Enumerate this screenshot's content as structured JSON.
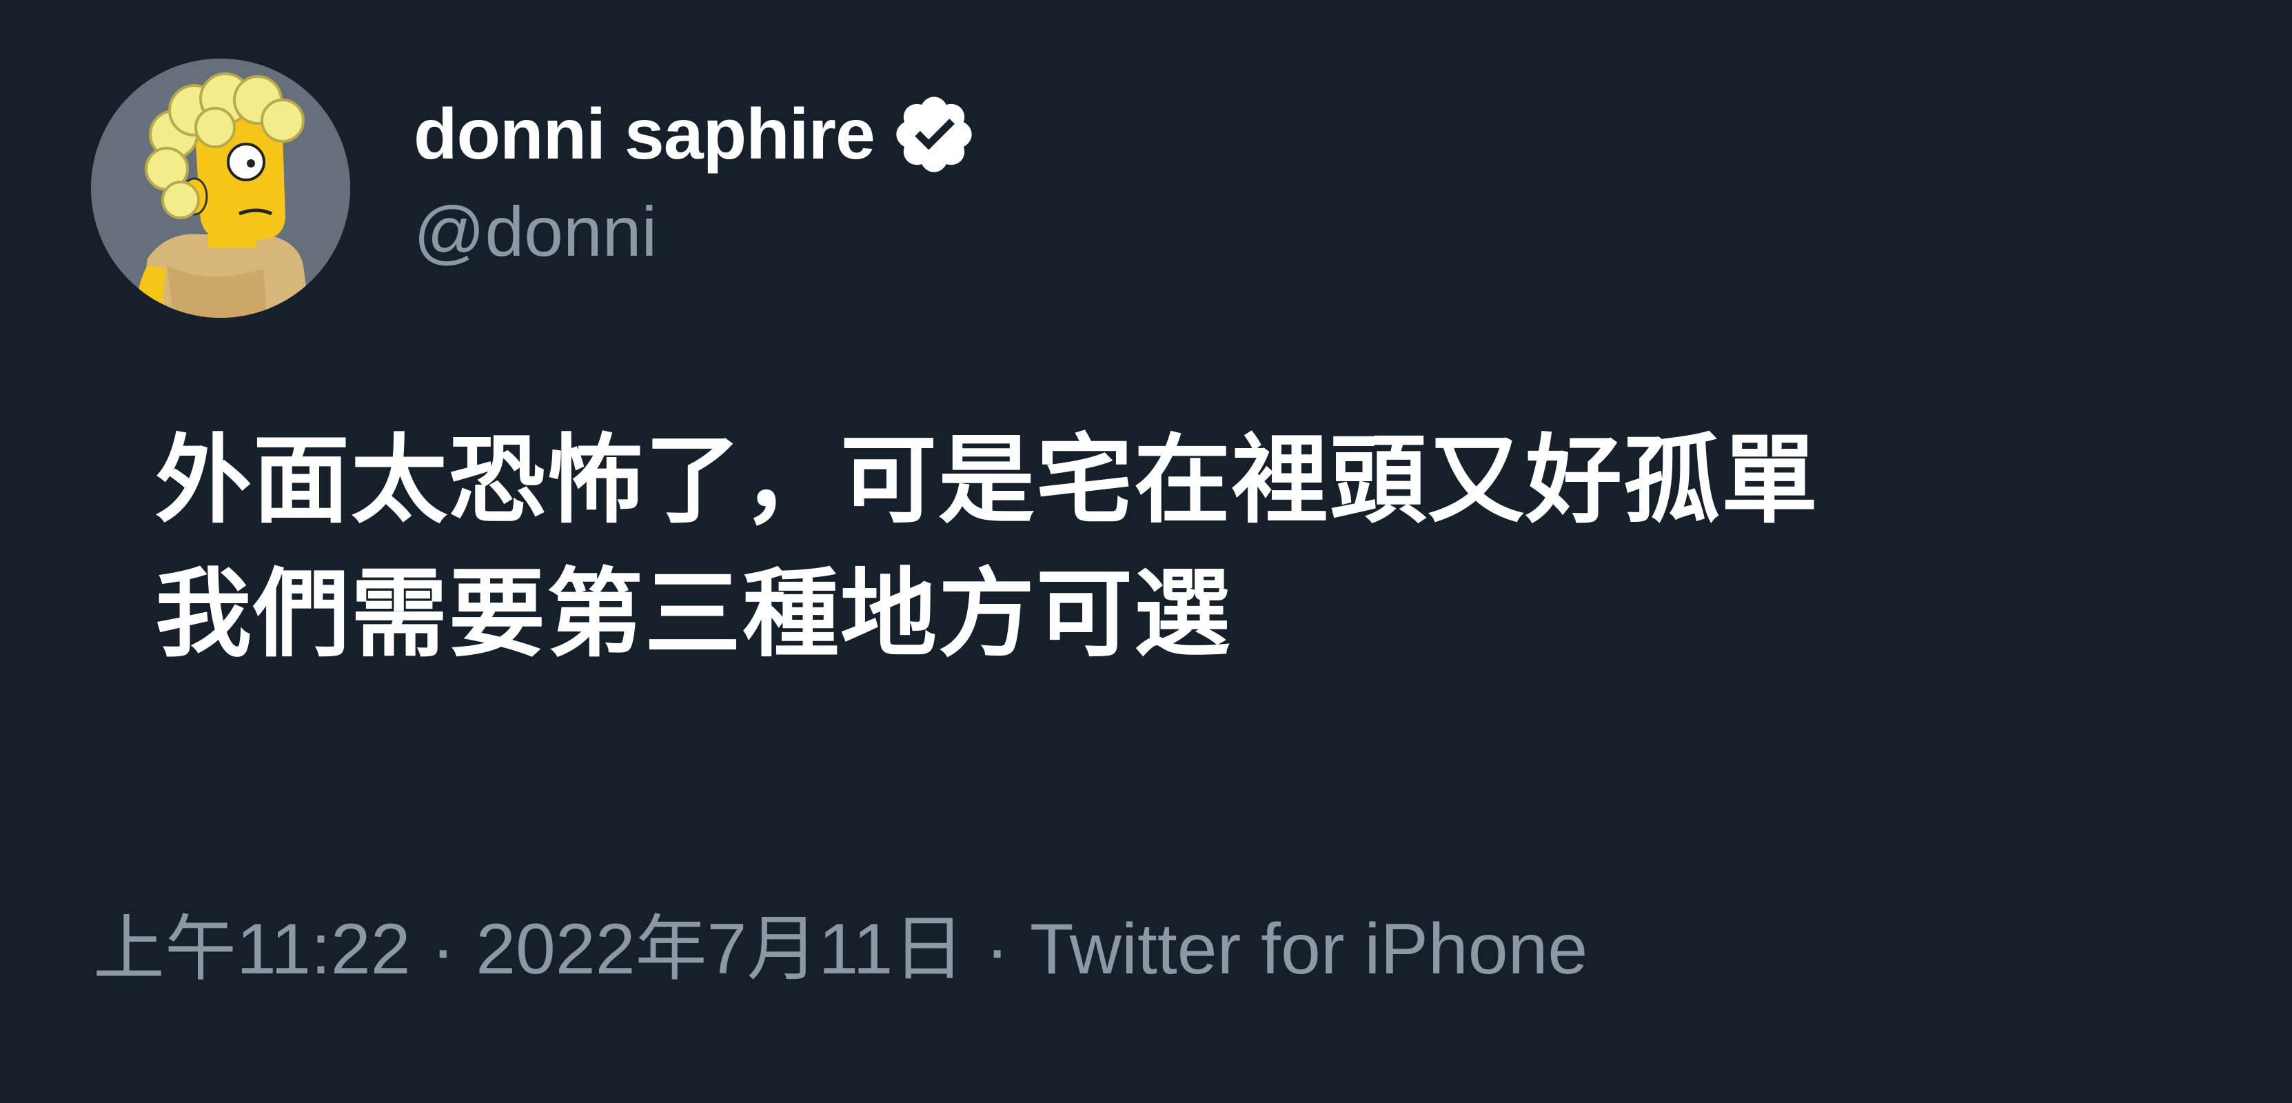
{
  "tweet": {
    "author": {
      "display_name": "donni saphire",
      "handle": "@donni",
      "verified": true,
      "avatar": "simpsons-style cartoon avatar"
    },
    "text_lines": [
      "外面太恐怖了，可是宅在裡頭又好孤單",
      "我們需要第三種地方可選"
    ],
    "meta": {
      "time": "上午11:22",
      "separator": "·",
      "date": "2022年7月11日",
      "source": "Twitter for iPhone"
    }
  },
  "colors": {
    "background": "#15202b",
    "primary_text": "#ffffff",
    "secondary_text": "#8b98a5",
    "avatar_bg": "#66707c"
  },
  "icons": {
    "verified": "verified-badge-icon"
  }
}
